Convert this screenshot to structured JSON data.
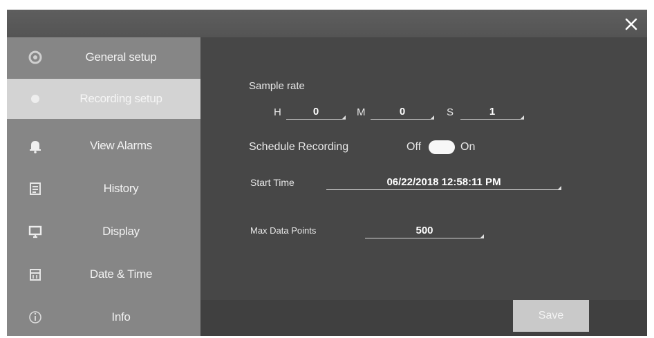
{
  "sidebar": {
    "items": [
      {
        "label": "General setup",
        "icon": "gear-icon"
      },
      {
        "label": "Recording setup",
        "icon": "recording-icon",
        "active": true
      },
      {
        "label": "View Alarms",
        "icon": "bell-icon"
      },
      {
        "label": "History",
        "icon": "history-icon"
      },
      {
        "label": "Display",
        "icon": "monitor-icon"
      },
      {
        "label": "Date & Time",
        "icon": "calendar-icon"
      },
      {
        "label": "Info",
        "icon": "info-icon"
      }
    ]
  },
  "recording": {
    "sample_rate_label": "Sample rate",
    "h_label": "H",
    "h_value": "0",
    "m_label": "M",
    "m_value": "0",
    "s_label": "S",
    "s_value": "1",
    "schedule_label": "Schedule Recording",
    "off_label": "Off",
    "on_label": "On",
    "start_time_label": "Start Time",
    "start_time_value": "06/22/2018 12:58:11 PM",
    "max_points_label": "Max Data Points",
    "max_points_value": "500",
    "save_label": "Save"
  },
  "colors": {
    "sidebar": "#868686",
    "active_item": "#d3d3d3",
    "content": "#474747",
    "toggle": "#f7f7f7"
  }
}
